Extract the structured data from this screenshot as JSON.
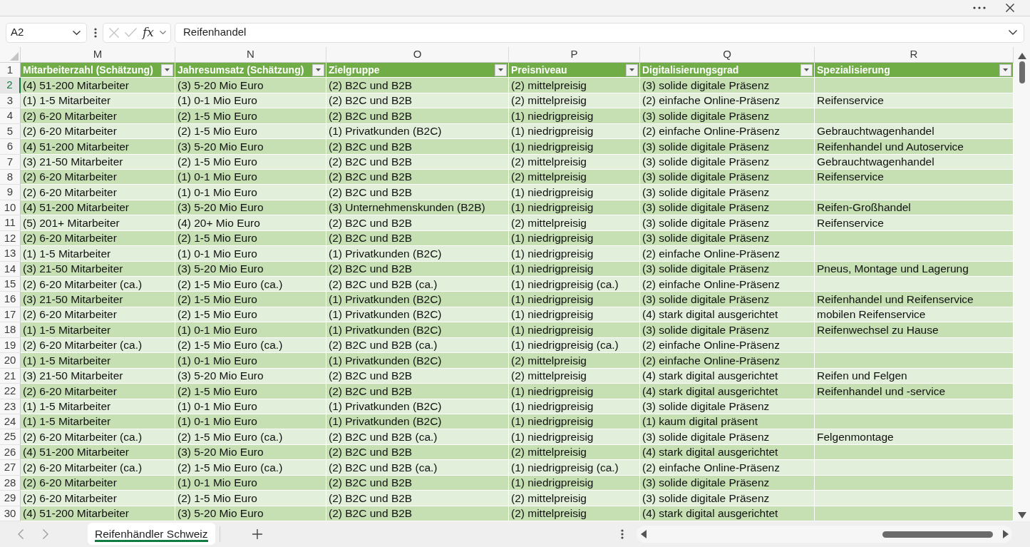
{
  "formula_bar": {
    "name_box": "A2",
    "editing": false,
    "function_button": "fx",
    "formula": "Reifenhandel"
  },
  "sheet": {
    "column_letters": [
      "M",
      "N",
      "O",
      "P",
      "Q",
      "R"
    ],
    "header_row": {
      "number": "1",
      "selected": false,
      "cells": [
        "Mitarbeiterzahl (Schätzung)",
        "Jahresumsatz (Schätzung)",
        "Zielgruppe",
        "Preisniveau",
        "Digitalisierungsgrad",
        "Spezialisierung"
      ]
    },
    "rows": [
      {
        "number": "2",
        "selected": true,
        "cells": [
          "(4) 51-200 Mitarbeiter",
          "(3) 5-20 Mio Euro",
          "(2) B2C und B2B",
          "(2) mittelpreisig",
          "(3) solide digitale Präsenz"
        ]
      },
      {
        "number": "3",
        "selected": false,
        "cells": [
          "(1) 1-5 Mitarbeiter",
          "(1) 0-1 Mio Euro",
          "(2) B2C und B2B",
          "(2) mittelpreisig",
          "(2) einfache Online-Präsenz",
          "Reifenservice"
        ]
      },
      {
        "number": "4",
        "selected": false,
        "cells": [
          "(2) 6-20 Mitarbeiter",
          "(2) 1-5 Mio Euro",
          "(2) B2C und B2B",
          "(1) niedrigpreisig",
          "(3) solide digitale Präsenz"
        ]
      },
      {
        "number": "5",
        "selected": false,
        "cells": [
          "(2) 6-20 Mitarbeiter",
          "(2) 1-5 Mio Euro",
          "(1) Privatkunden (B2C)",
          "(1) niedrigpreisig",
          "(2) einfache Online-Präsenz",
          "Gebrauchtwagenhandel"
        ]
      },
      {
        "number": "6",
        "selected": false,
        "cells": [
          "(4) 51-200 Mitarbeiter",
          "(3) 5-20 Mio Euro",
          "(2) B2C und B2B",
          "(1) niedrigpreisig",
          "(3) solide digitale Präsenz",
          "Reifenhandel und Autoservice"
        ]
      },
      {
        "number": "7",
        "selected": false,
        "cells": [
          "(3) 21-50 Mitarbeiter",
          "(2) 1-5 Mio Euro",
          "(2) B2C und B2B",
          "(2) mittelpreisig",
          "(3) solide digitale Präsenz",
          "Gebrauchtwagenhandel"
        ]
      },
      {
        "number": "8",
        "selected": false,
        "cells": [
          "(2) 6-20 Mitarbeiter",
          "(1) 0-1 Mio Euro",
          "(2) B2C und B2B",
          "(2) mittelpreisig",
          "(3) solide digitale Präsenz",
          "Reifenservice"
        ]
      },
      {
        "number": "9",
        "selected": false,
        "cells": [
          "(2) 6-20 Mitarbeiter",
          "(1) 0-1 Mio Euro",
          "(2) B2C und B2B",
          "(1) niedrigpreisig",
          "(3) solide digitale Präsenz"
        ]
      },
      {
        "number": "10",
        "selected": false,
        "cells": [
          "(4) 51-200 Mitarbeiter",
          "(3) 5-20 Mio Euro",
          "(3) Unternehmenskunden (B2B)",
          "(1) niedrigpreisig",
          "(3) solide digitale Präsenz",
          "Reifen-Großhandel"
        ]
      },
      {
        "number": "11",
        "selected": false,
        "cells": [
          "(5) 201+ Mitarbeiter",
          "(4) 20+ Mio Euro",
          "(2) B2C und B2B",
          "(2) mittelpreisig",
          "(3) solide digitale Präsenz",
          "Reifenservice"
        ]
      },
      {
        "number": "12",
        "selected": false,
        "cells": [
          "(2) 6-20 Mitarbeiter",
          "(2) 1-5 Mio Euro",
          "(2) B2C und B2B",
          "(1) niedrigpreisig",
          "(3) solide digitale Präsenz"
        ]
      },
      {
        "number": "13",
        "selected": false,
        "cells": [
          "(1) 1-5 Mitarbeiter",
          "(1) 0-1 Mio Euro",
          "(1) Privatkunden (B2C)",
          "(1) niedrigpreisig",
          "(2) einfache Online-Präsenz"
        ]
      },
      {
        "number": "14",
        "selected": false,
        "cells": [
          "(3) 21-50 Mitarbeiter",
          "(3) 5-20 Mio Euro",
          "(2) B2C und B2B",
          "(1) niedrigpreisig",
          "(3) solide digitale Präsenz",
          "Pneus, Montage und Lagerung"
        ]
      },
      {
        "number": "15",
        "selected": false,
        "cells": [
          "(2) 6-20 Mitarbeiter (ca.)",
          "(2) 1-5 Mio Euro (ca.)",
          "(2) B2C und B2B (ca.)",
          "(1) niedrigpreisig (ca.)",
          "(2) einfache Online-Präsenz"
        ]
      },
      {
        "number": "16",
        "selected": false,
        "cells": [
          "(3) 21-50 Mitarbeiter",
          "(2) 1-5 Mio Euro",
          "(1) Privatkunden (B2C)",
          "(1) niedrigpreisig",
          "(3) solide digitale Präsenz",
          "Reifenhandel und Reifenservice"
        ]
      },
      {
        "number": "17",
        "selected": false,
        "cells": [
          "(2) 6-20 Mitarbeiter",
          "(2) 1-5 Mio Euro",
          "(1) Privatkunden (B2C)",
          "(1) niedrigpreisig",
          "(4) stark digital ausgerichtet",
          "mobilen Reifenservice"
        ]
      },
      {
        "number": "18",
        "selected": false,
        "cells": [
          "(1) 1-5 Mitarbeiter",
          "(1) 0-1 Mio Euro",
          "(1) Privatkunden (B2C)",
          "(1) niedrigpreisig",
          "(3) solide digitale Präsenz",
          "Reifenwechsel zu Hause"
        ]
      },
      {
        "number": "19",
        "selected": false,
        "cells": [
          "(2) 6-20 Mitarbeiter (ca.)",
          "(2) 1-5 Mio Euro (ca.)",
          "(2) B2C und B2B (ca.)",
          "(1) niedrigpreisig (ca.)",
          "(2) einfache Online-Präsenz"
        ]
      },
      {
        "number": "20",
        "selected": false,
        "cells": [
          "(1) 1-5 Mitarbeiter",
          "(1) 0-1 Mio Euro",
          "(1) Privatkunden (B2C)",
          "(2) mittelpreisig",
          "(2) einfache Online-Präsenz"
        ]
      },
      {
        "number": "21",
        "selected": false,
        "cells": [
          "(3) 21-50 Mitarbeiter",
          "(3) 5-20 Mio Euro",
          "(2) B2C und B2B",
          "(2) mittelpreisig",
          "(4) stark digital ausgerichtet",
          "Reifen und Felgen"
        ]
      },
      {
        "number": "22",
        "selected": false,
        "cells": [
          "(2) 6-20 Mitarbeiter",
          "(2) 1-5 Mio Euro",
          "(2) B2C und B2B",
          "(1) niedrigpreisig",
          "(4) stark digital ausgerichtet",
          "Reifenhandel und -service"
        ]
      },
      {
        "number": "23",
        "selected": false,
        "cells": [
          "(1) 1-5 Mitarbeiter",
          "(1) 0-1 Mio Euro",
          "(1) Privatkunden (B2C)",
          "(1) niedrigpreisig",
          "(3) solide digitale Präsenz"
        ]
      },
      {
        "number": "24",
        "selected": false,
        "cells": [
          "(1) 1-5 Mitarbeiter",
          "(1) 0-1 Mio Euro",
          "(1) Privatkunden (B2C)",
          "(1) niedrigpreisig",
          "(1) kaum digital präsent"
        ]
      },
      {
        "number": "25",
        "selected": false,
        "cells": [
          "(2) 6-20 Mitarbeiter (ca.)",
          "(2) 1-5 Mio Euro (ca.)",
          "(2) B2C und B2B (ca.)",
          "(1) niedrigpreisig",
          "(3) solide digitale Präsenz",
          "Felgenmontage"
        ]
      },
      {
        "number": "26",
        "selected": false,
        "cells": [
          "(4) 51-200 Mitarbeiter",
          "(3) 5-20 Mio Euro",
          "(2) B2C und B2B",
          "(2) mittelpreisig",
          "(4) stark digital ausgerichtet"
        ]
      },
      {
        "number": "27",
        "selected": false,
        "cells": [
          "(2) 6-20 Mitarbeiter (ca.)",
          "(2) 1-5 Mio Euro (ca.)",
          "(2) B2C und B2B (ca.)",
          "(1) niedrigpreisig (ca.)",
          "(2) einfache Online-Präsenz"
        ]
      },
      {
        "number": "28",
        "selected": false,
        "cells": [
          "(2) 6-20 Mitarbeiter",
          "(1) 0-1 Mio Euro",
          "(2) B2C und B2B",
          "(1) niedrigpreisig",
          "(3) solide digitale Präsenz"
        ]
      },
      {
        "number": "29",
        "selected": false,
        "cells": [
          "(2) 6-20 Mitarbeiter",
          "(2) 1-5 Mio Euro",
          "(2) B2C und B2B",
          "(2) mittelpreisig",
          "(3) solide digitale Präsenz"
        ]
      },
      {
        "number": "30",
        "selected": false,
        "cells": [
          "(4) 51-200 Mitarbeiter",
          "(3) 5-20 Mio Euro",
          "(2) B2C und B2B",
          "(2) mittelpreisig",
          "(4) stark digital ausgerichtet"
        ]
      }
    ]
  },
  "sheet_tabs": [
    {
      "label": "Reifenhändler Schweiz",
      "selected": true
    }
  ]
}
